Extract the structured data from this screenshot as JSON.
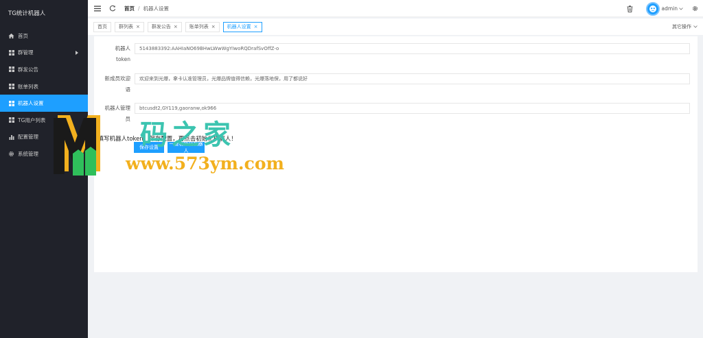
{
  "sidebar": {
    "brand": "TG统计机器人",
    "items": [
      {
        "label": "首页",
        "icon": "home-icon"
      },
      {
        "label": "群管理",
        "icon": "grid-icon",
        "has_children": true
      },
      {
        "label": "群发公告",
        "icon": "grid-icon"
      },
      {
        "label": "账单列表",
        "icon": "grid-icon"
      },
      {
        "label": "机器人设置",
        "icon": "grid-icon",
        "active": true
      },
      {
        "label": "TG用户列表",
        "icon": "grid-icon"
      },
      {
        "label": "配置管理",
        "icon": "bar-chart-icon"
      },
      {
        "label": "系统管理",
        "icon": "gear-icon"
      }
    ]
  },
  "header": {
    "breadcrumb_home": "首页",
    "breadcrumb_separator": "/",
    "breadcrumb_current": "机器人设置",
    "username": "admin"
  },
  "tabs": {
    "items": [
      {
        "label": "首页",
        "closable": false
      },
      {
        "label": "群列表",
        "closable": true
      },
      {
        "label": "群发公告",
        "closable": true
      },
      {
        "label": "账单列表",
        "closable": true
      },
      {
        "label": "机器人设置",
        "closable": true,
        "active": true
      }
    ],
    "close_glyph": "×",
    "more_ops": "其它操作"
  },
  "form": {
    "token_label_line1": "机器人",
    "token_label_line2": "token",
    "token_value": "5143883392:AAHIaNO69BHwLWwWgYIwoRQDrafSvOffZ-o",
    "welcome_label_line1": "新成员欢迎",
    "welcome_label_line2": "语",
    "welcome_value": "欢迎来到光爆，拿卡认准管理员，光爆品牌值得信赖，光爆落地保，用了都说好",
    "admin_label_line1": "机器人管理",
    "admin_label_line2": "员",
    "admin_value": "btcusdt2,GY119,gaoranw,ok966",
    "notice": "先填写机器人token，保存配置，再点击初始化机器人！",
    "save_button": "保存设置",
    "init_button": "一键初始化机器人"
  },
  "watermark": {
    "cn_text": "码之家",
    "url_text": "www.573ym.com",
    "logo_letter": "M"
  },
  "colors": {
    "sidebar_bg": "#20222a",
    "accent": "#1e9fff",
    "watermark_teal": "#3cc4b0",
    "watermark_gold": "#f2b01e"
  }
}
